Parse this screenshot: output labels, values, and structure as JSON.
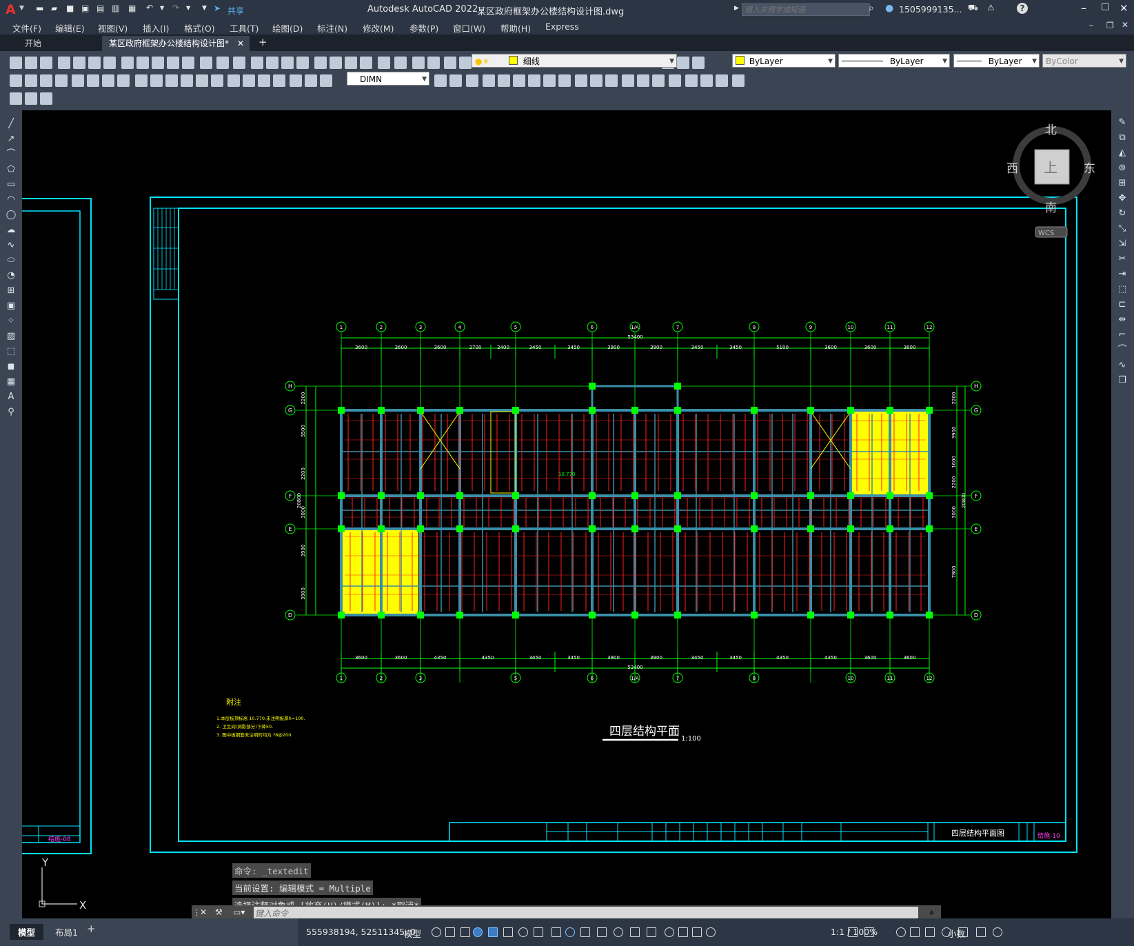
{
  "app": {
    "title": "Autodesk AutoCAD 2022",
    "file": "某区政府框架办公楼结构设计图.dwg",
    "share": "共享",
    "search_placeholder": "键入关键字或短语",
    "user": "1505999135...",
    "logo": "A"
  },
  "menu": [
    "文件(F)",
    "编辑(E)",
    "视图(V)",
    "插入(I)",
    "格式(O)",
    "工具(T)",
    "绘图(D)",
    "标注(N)",
    "修改(M)",
    "参数(P)",
    "窗口(W)",
    "帮助(H)",
    "Express"
  ],
  "tabs": {
    "start": "开始",
    "active": "某区政府框架办公楼结构设计图*"
  },
  "toolbar": {
    "layer": "细线",
    "color": "ByLayer",
    "linetype": "ByLayer",
    "lineweight": "ByLayer",
    "plotstyle": "ByColor",
    "dimstyle": "DIMN"
  },
  "viewcube": {
    "north": "北",
    "south": "南",
    "west": "西",
    "east": "东",
    "top": "上",
    "wcs": "WCS"
  },
  "drawing": {
    "grid_top": [
      "1",
      "2",
      "3",
      "4",
      "5",
      "6",
      "1/A",
      "7",
      "8",
      "9",
      "10",
      "11",
      "12"
    ],
    "grid_bottom": [
      "1",
      "2",
      "3",
      "5",
      "6",
      "1/A",
      "7",
      "8",
      "10",
      "11",
      "12"
    ],
    "grid_rows": [
      "H",
      "G",
      "F",
      "E",
      "D"
    ],
    "dims_top": [
      "3600",
      "3600",
      "3600",
      "2700",
      "2400",
      "3450",
      "3450",
      "3900",
      "3900",
      "3450",
      "3450",
      "5100",
      "3600",
      "3600",
      "3600"
    ],
    "dims_bottom": [
      "3600",
      "3600",
      "4350",
      "4350",
      "3450",
      "3450",
      "3900",
      "3900",
      "3450",
      "3450",
      "4350",
      "4350",
      "3600",
      "3600"
    ],
    "total_width": "53400",
    "dims_left": [
      "2200",
      "5500",
      "2200",
      "3000",
      "3900",
      "3900"
    ],
    "dims_right": [
      "2200",
      "3900",
      "1600",
      "2200",
      "3000",
      "7800"
    ],
    "total_height": "20800",
    "elevation": "10.770",
    "notes_title": "附注",
    "notes": [
      "1.本层板顶标高 10.770,未注明板厚h=100.",
      "2. 卫生间(洞影部分)下降50.",
      "3. 图中板钢筋未注明的均为 ?8@200."
    ],
    "plan_title": "四层结构平面",
    "plan_scale": "1:100",
    "titleblock_name": "四层结构平面图",
    "sheet_no": "结施-10",
    "left_sheet_no": "结施-08"
  },
  "ucs": {
    "x": "X",
    "y": "Y"
  },
  "command": {
    "history": [
      "命令: _textedit",
      "当前设置: 编辑模式 = Multiple",
      "选择注释对象或 [放弃(U)/模式(M)]: *取消*"
    ],
    "placeholder": "键入命令"
  },
  "status": {
    "model_tab": "模型",
    "layout_tab": "布局1",
    "add": "+",
    "coords": "555938194, 52511345, 0",
    "space": "模型",
    "scale": "1:1 / 100%",
    "units": "小数"
  },
  "colors": {
    "background": "#000000",
    "grid": "#00ff00",
    "frame": "#00e5ff",
    "beam": "#3a8fa8",
    "hatch": "#ffff00",
    "column": "#00ff00",
    "red": "#ff2020"
  }
}
